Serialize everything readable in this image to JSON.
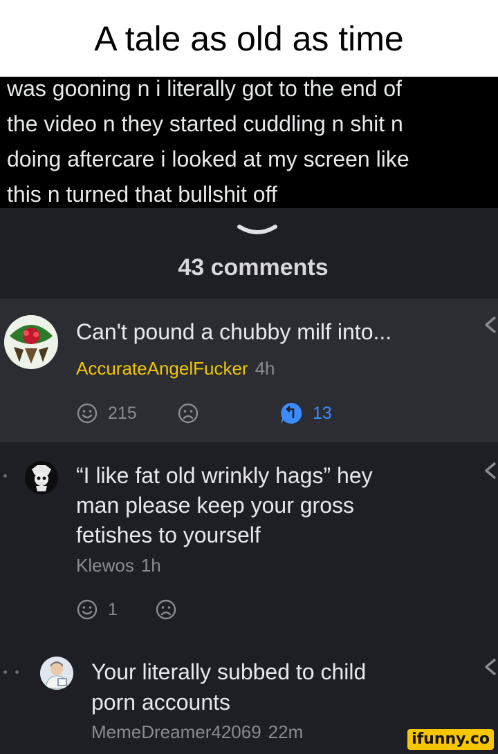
{
  "meme_title": "A tale as old as time",
  "tweet": {
    "lines": [
      "was gooning n i literally got to the end of",
      "the video n they started cuddling n shit n",
      "doing aftercare i looked at my screen like",
      "this n turned that bullshit off"
    ]
  },
  "comments_header": "43 comments",
  "comments": [
    {
      "text_lines": [
        "Can't pound a chubby milf into..."
      ],
      "username": "AccurateAngelFucker",
      "time": "4h",
      "likes": "215",
      "replies": "13"
    },
    {
      "text_lines": [
        "“I like fat old wrinkly hags” hey",
        "man please keep your gross",
        "fetishes to yourself"
      ],
      "username": "Klewos",
      "time": "1h",
      "likes": "1"
    },
    {
      "text_lines": [
        "Your literally subbed to child",
        "porn accounts"
      ],
      "username": "MemeDreamer42069",
      "time": "22m"
    }
  ],
  "watermark": "ifunny.co",
  "colors": {
    "username_accent": "#f2c500",
    "reply_badge": "#3a8cff",
    "muted": "#8a8b90"
  }
}
